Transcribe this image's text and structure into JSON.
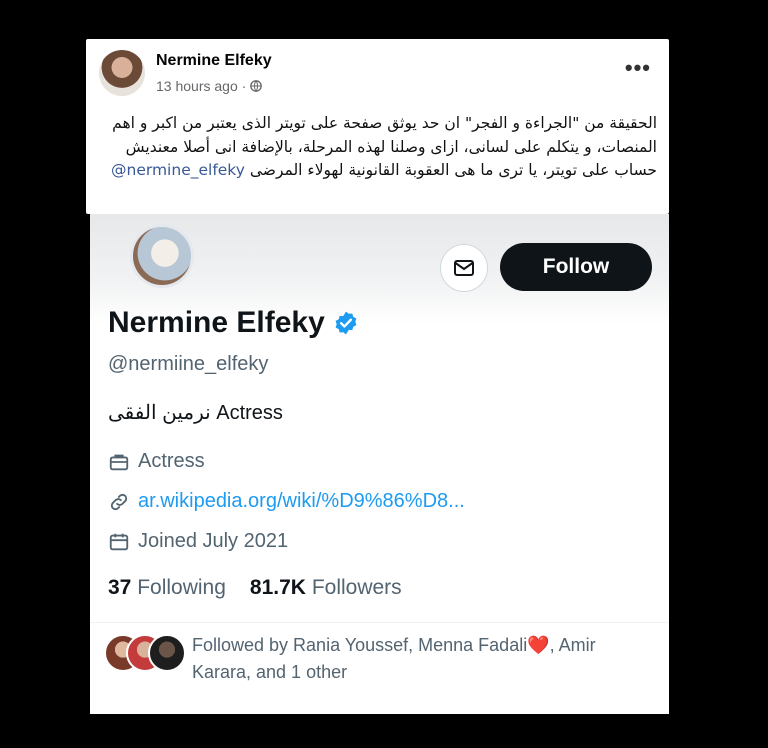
{
  "facebook_post": {
    "author": "Nermine Elfeky",
    "time": "13 hours ago ·",
    "text": "الحقيقة من \"الجراءة و الفجر\" ان حد يوثق صفحة على تويتر الذى يعتبر من اكبر و اهم المنصات، و يتكلم على لسانى، ازاى وصلنا لهذه المرحلة، بالإضافة انى أصلا معنديش حساب على تويتر، يا ترى ما هى العقوبة القانونية لهولاء المرضى",
    "mention": "@nermine_elfeky",
    "icons": {
      "privacy": "globe-icon",
      "more": "more-options-icon"
    }
  },
  "twitter_profile": {
    "follow_label": "Follow",
    "name": "Nermine Elfeky",
    "handle": "@nermiine_elfeky",
    "bio": "نرمين الفقى Actress",
    "category": "Actress",
    "link": "ar.wikipedia.org/wiki/%D9%86%D8...",
    "joined": "Joined July 2021",
    "following_count": "37",
    "following_label": "Following",
    "followers_count": "81.7K",
    "followers_label": "Followers",
    "followed_by": "Followed by Rania Youssef, Menna Fadali",
    "followed_by_heart": "❤️",
    "followed_by_rest": ", Amir Karara, and 1 other",
    "colors": {
      "accent": "#1d9bf0",
      "button": "#0f1419",
      "secondary_text": "#536471"
    }
  }
}
